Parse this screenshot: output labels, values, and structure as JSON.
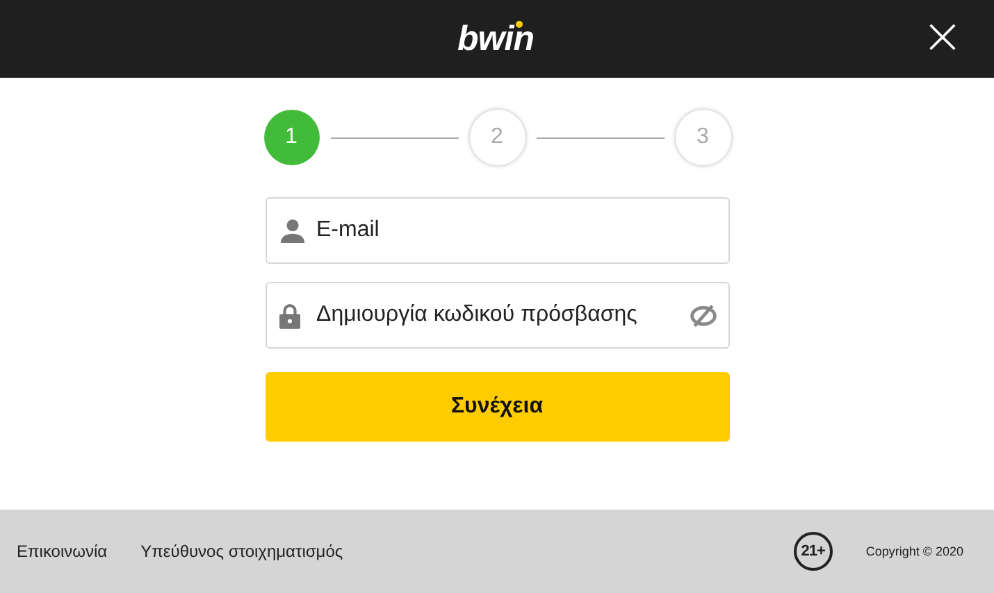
{
  "header": {
    "logo": "bwin",
    "close": "×"
  },
  "steps": [
    {
      "label": "1",
      "selected": true
    },
    {
      "label": "2",
      "selected": false
    },
    {
      "label": "3",
      "selected": false
    }
  ],
  "fields": [
    {
      "kind": "email",
      "placeholder": "E-mail"
    },
    {
      "kind": "password",
      "placeholder": "Δημιουργία κωδικού πρόσβασης"
    }
  ],
  "submit": "Συνέχεια",
  "footer": {
    "links": [
      "Επικοινωνία",
      "Υπεύθυνος στοιχηματισμός"
    ],
    "age_badge": "21+",
    "copyright": "Copyright © 2020"
  }
}
